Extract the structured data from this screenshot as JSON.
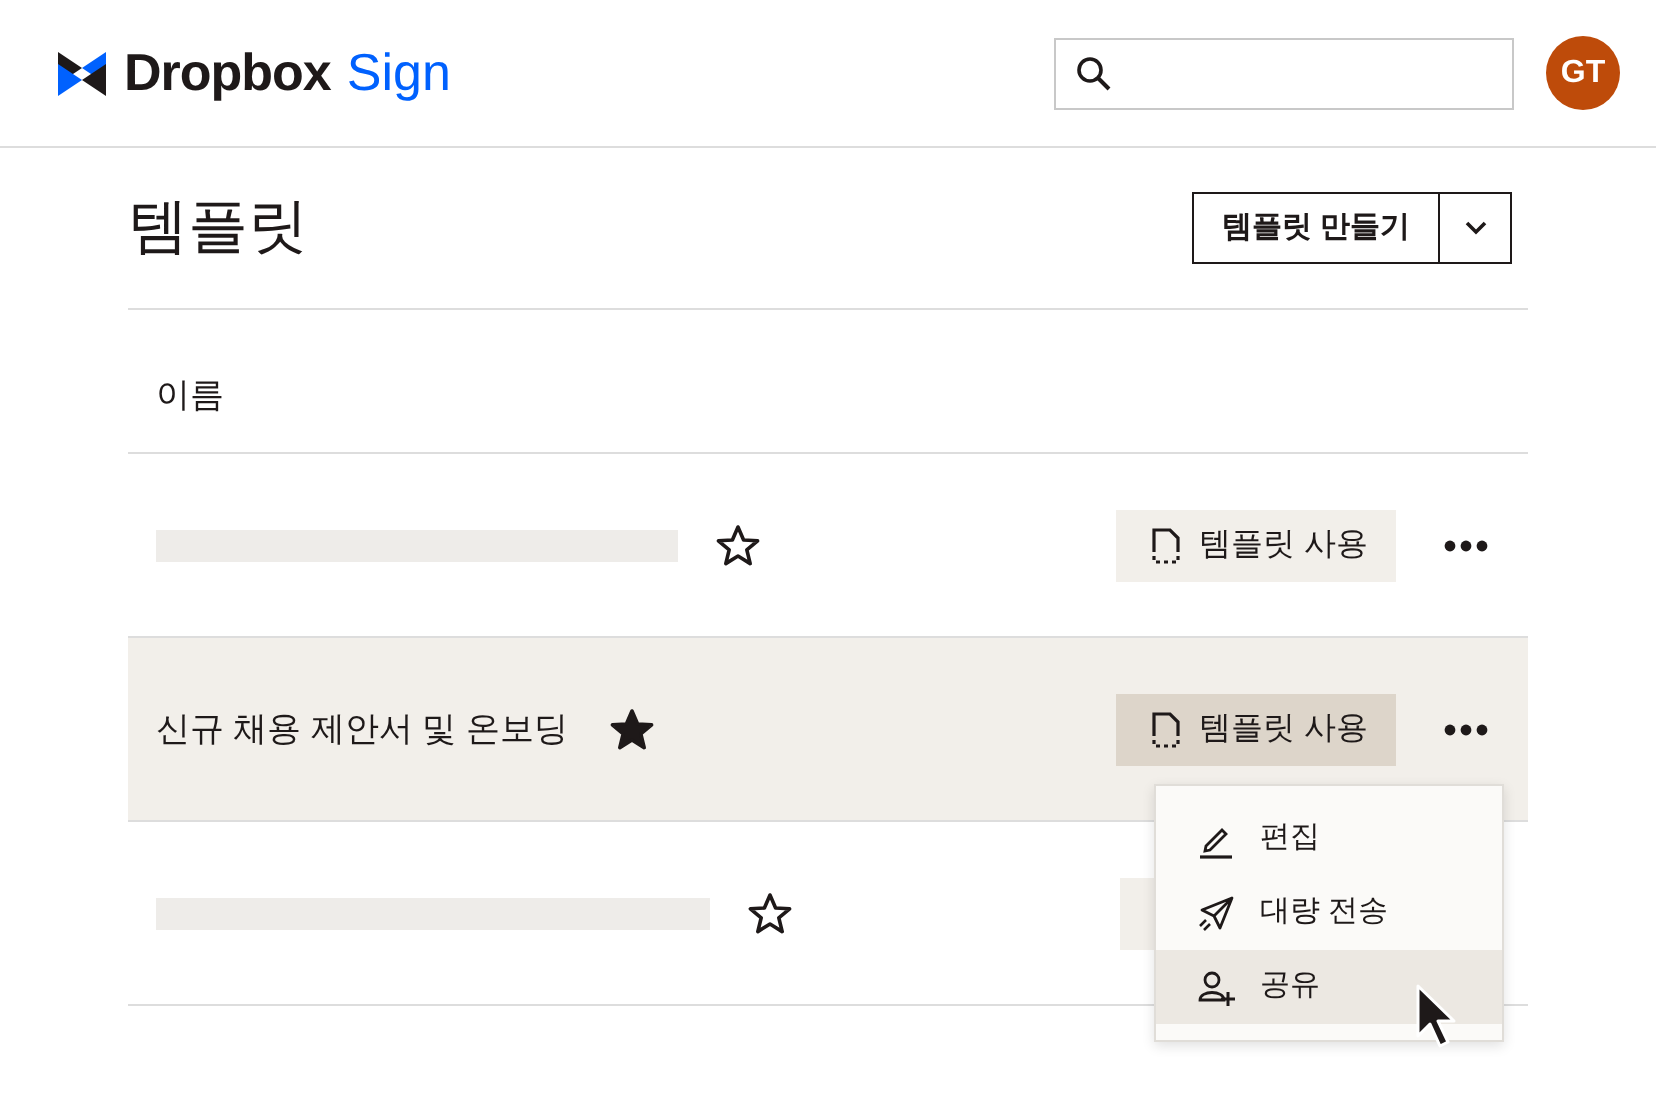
{
  "header": {
    "logo_word": "Dropbox",
    "logo_accent": "Sign",
    "avatar": "GT"
  },
  "page": {
    "title": "템플릿",
    "create_button": "템플릿 만들기"
  },
  "table": {
    "columns": [
      "이름"
    ],
    "rows": [
      {
        "name": null,
        "starred": false,
        "selected": false,
        "use_button": "템플릿 사용"
      },
      {
        "name": "신규 채용 제안서 및 온보딩",
        "starred": true,
        "selected": true,
        "use_button": "템플릿 사용"
      },
      {
        "name": null,
        "starred": false,
        "selected": false,
        "use_button": null
      }
    ]
  },
  "menu": {
    "items": [
      {
        "kind": "edit",
        "label": "편집",
        "selected": false
      },
      {
        "kind": "send",
        "label": "대량 전송",
        "selected": false
      },
      {
        "kind": "share",
        "label": "공유",
        "selected": true
      }
    ]
  }
}
